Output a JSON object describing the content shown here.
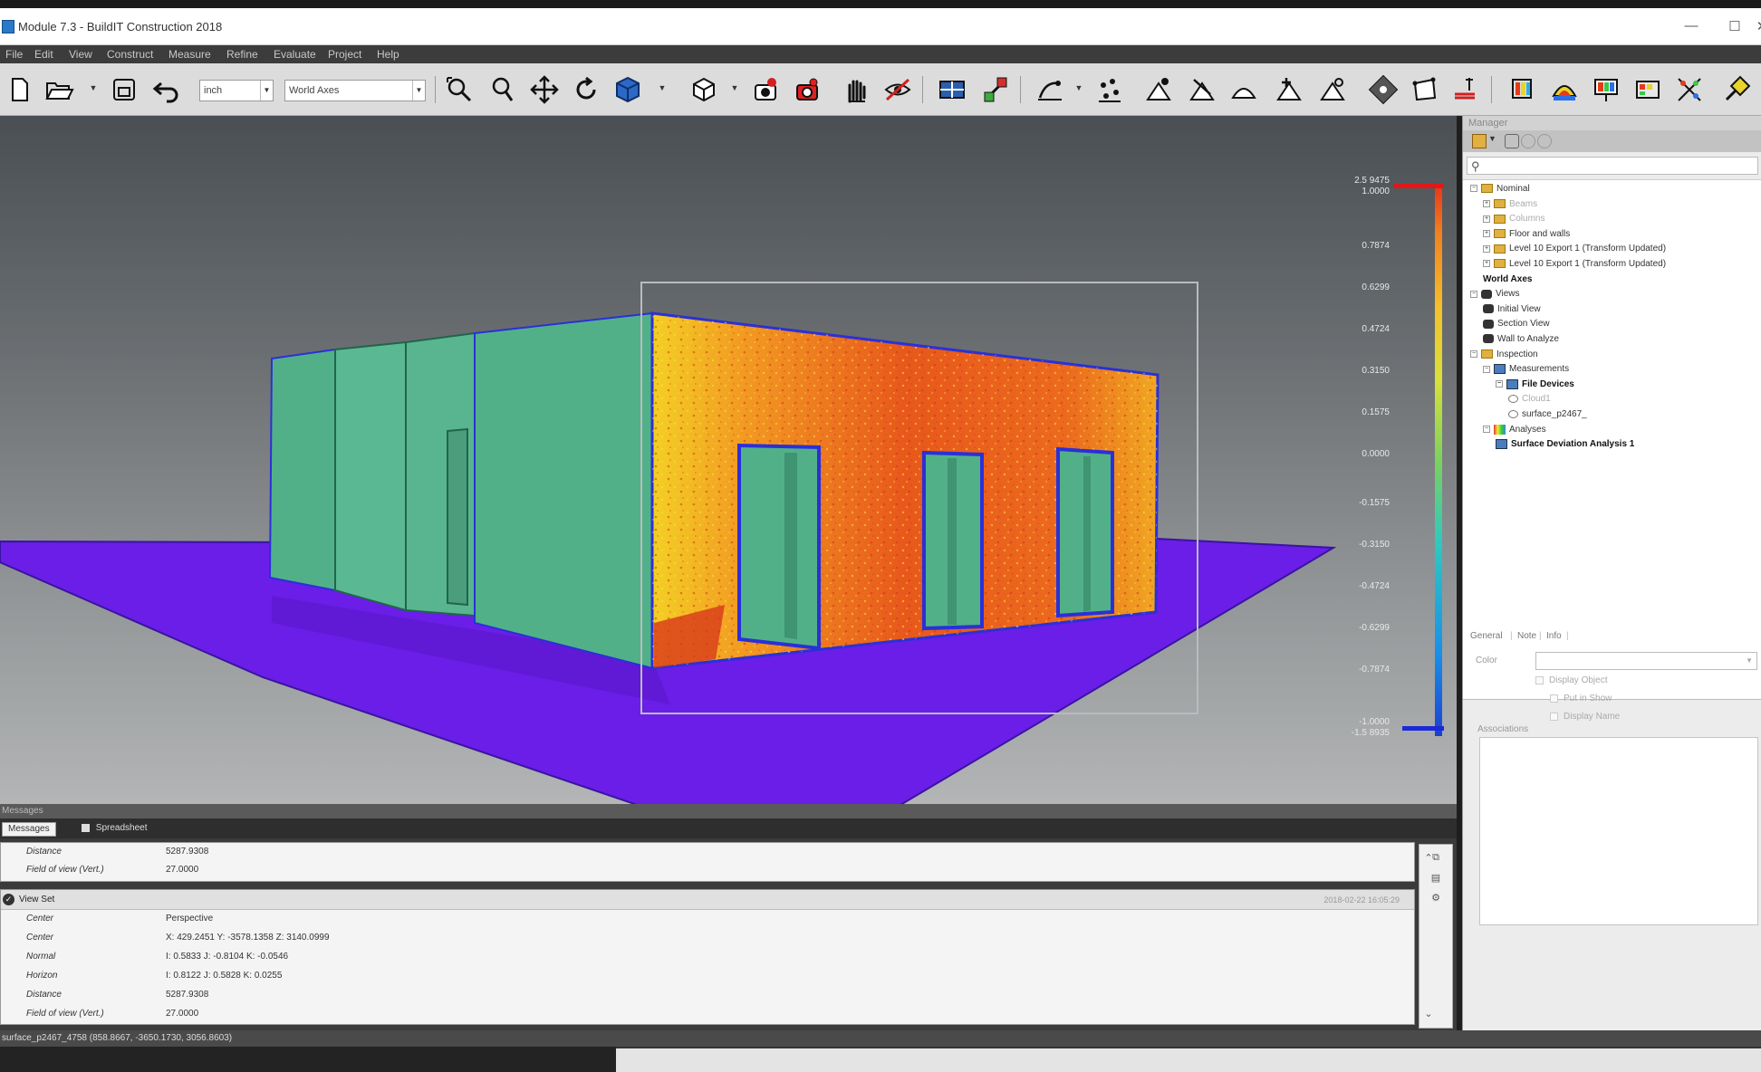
{
  "window": {
    "title": "Module 7.3 - BuildIT Construction 2018",
    "minimize": "—",
    "maximize": "☐",
    "close": "✕"
  },
  "menu": [
    "File",
    "Edit",
    "View",
    "Construct",
    "Measure",
    "Refine",
    "Evaluate",
    "Project",
    "Help"
  ],
  "toolbar": {
    "units_value": "inch",
    "coord_value": "World Axes"
  },
  "viewport": {
    "colorbar_ticks": [
      "2.5 9475",
      "1.0000",
      "0.7874",
      "0.6299",
      "0.4724",
      "0.3150",
      "0.1575",
      "0.0000",
      "-0.1575",
      "-0.3150",
      "-0.4724",
      "-0.6299",
      "-0.7874",
      "-1.0000",
      "-1.5 8935"
    ],
    "colors": {
      "wall": "#52b089",
      "floor": "#6a1ee8",
      "edge": "#2a30d8",
      "deviation_hot": "#e2461c",
      "deviation_warm": "#f2a81e"
    }
  },
  "manager": {
    "title": "Manager",
    "tree": [
      {
        "label": "Nominal",
        "indent": 0,
        "icon": "folder",
        "exp": "−",
        "style": ""
      },
      {
        "label": "Beams",
        "indent": 1,
        "icon": "folder",
        "exp": "+",
        "style": "dim"
      },
      {
        "label": "Columns",
        "indent": 1,
        "icon": "folder",
        "exp": "+",
        "style": "dim"
      },
      {
        "label": "Floor and walls",
        "indent": 1,
        "icon": "folder",
        "exp": "+",
        "style": ""
      },
      {
        "label": "Level 10 Export 1 (Transform Updated)",
        "indent": 1,
        "icon": "folder",
        "exp": "+",
        "style": ""
      },
      {
        "label": "Level 10 Export 1 (Transform Updated)",
        "indent": 1,
        "icon": "folder",
        "exp": "+",
        "style": ""
      },
      {
        "label": "World Axes",
        "indent": 1,
        "icon": "none",
        "exp": "",
        "style": "bold"
      },
      {
        "label": "Views",
        "indent": 0,
        "icon": "camera",
        "exp": "−",
        "style": ""
      },
      {
        "label": "Initial View",
        "indent": 1,
        "icon": "camera",
        "exp": "",
        "style": ""
      },
      {
        "label": "Section View",
        "indent": 1,
        "icon": "camera",
        "exp": "",
        "style": ""
      },
      {
        "label": "Wall to Analyze",
        "indent": 1,
        "icon": "camera",
        "exp": "",
        "style": ""
      },
      {
        "label": "Inspection",
        "indent": 0,
        "icon": "folder",
        "exp": "−",
        "style": ""
      },
      {
        "label": "Measurements",
        "indent": 1,
        "icon": "measure",
        "exp": "−",
        "style": ""
      },
      {
        "label": "File Devices",
        "indent": 2,
        "icon": "measure",
        "exp": "−",
        "style": "bold"
      },
      {
        "label": "Cloud1",
        "indent": 3,
        "icon": "object",
        "exp": "",
        "style": "dim"
      },
      {
        "label": "surface_p2467_",
        "indent": 3,
        "icon": "object",
        "exp": "",
        "style": ""
      },
      {
        "label": "Analyses",
        "indent": 1,
        "icon": "analysis",
        "exp": "−",
        "style": ""
      },
      {
        "label": "Surface Deviation Analysis 1",
        "indent": 2,
        "icon": "measure",
        "exp": "",
        "style": "bold"
      }
    ],
    "tabs": [
      "General",
      "Note",
      "Info"
    ],
    "color_label": "Color",
    "checkboxes": [
      "Display Object",
      "Put in Show",
      "Display Name"
    ],
    "associations_label": "Associations"
  },
  "messages": {
    "header": "Messages",
    "tabs": [
      "Messages",
      "Spreadsheet"
    ],
    "block1": [
      {
        "k": "Distance",
        "v": "5287.9308"
      },
      {
        "k": "Field of view (Vert.)",
        "v": "27.0000"
      }
    ],
    "block2_title": "View Set",
    "block2_time": "2018-02-22 16:05:29",
    "block2": [
      {
        "k": "Center",
        "v": "Perspective"
      },
      {
        "k": "Center",
        "v": "X: 429.2451  Y: -3578.1358  Z: 3140.0999"
      },
      {
        "k": "Normal",
        "v": "I: 0.5833  J: -0.8104  K: -0.0546"
      },
      {
        "k": "Horizon",
        "v": "I: 0.8122  J: 0.5828  K: 0.0255"
      },
      {
        "k": "Distance",
        "v": "5287.9308"
      },
      {
        "k": "Field of view (Vert.)",
        "v": "27.0000"
      }
    ]
  },
  "status": {
    "text": "surface_p2467_4758   (858.8667, -3650.1730, 3056.8603)"
  }
}
